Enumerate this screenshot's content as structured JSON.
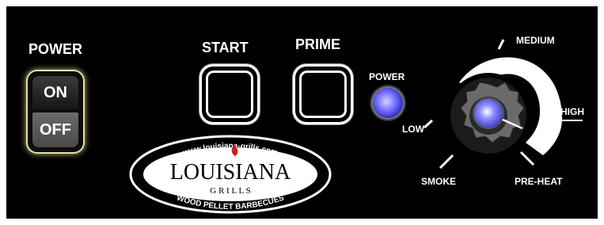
{
  "power": {
    "title": "POWER",
    "on_label": "ON",
    "off_label": "OFF"
  },
  "buttons": {
    "start_label": "START",
    "prime_label": "PRIME"
  },
  "indicator": {
    "label": "POWER",
    "color": "#7f7dff"
  },
  "logo": {
    "url": "www.louisiana-grills.com",
    "brand": "LOUISIANA",
    "sub": "G R I L L S",
    "tagline": "WOOD PELLET BARBECUES",
    "flame_color": "#c81e1e"
  },
  "dial": {
    "labels": {
      "smoke": "SMOKE",
      "low": "LOW",
      "medium": "MEDIUM",
      "high": "HIGH",
      "preheat": "PRE-HEAT"
    },
    "knob_color": "#8f8dff"
  }
}
